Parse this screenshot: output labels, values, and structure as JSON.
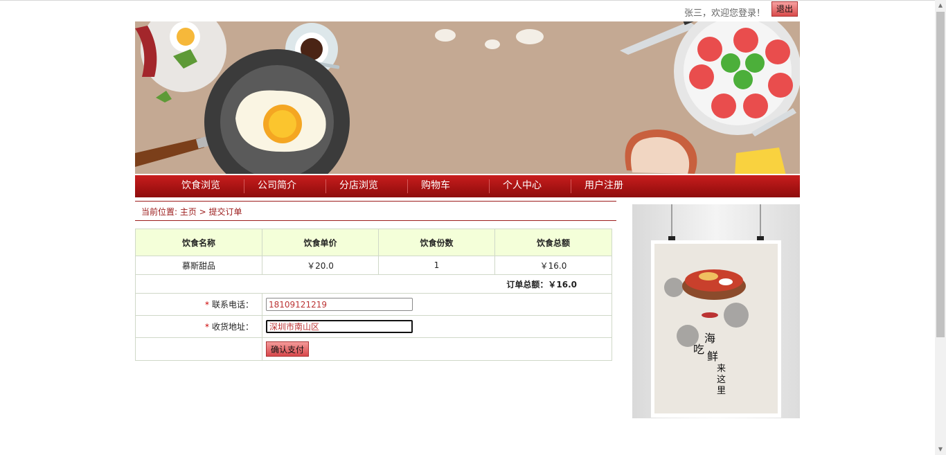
{
  "header": {
    "welcome_text": "张三，欢迎您登录！",
    "logout_label": "退出"
  },
  "nav": {
    "items": [
      "饮食浏览",
      "公司简介",
      "分店浏览",
      "购物车",
      "个人中心",
      "用户注册"
    ]
  },
  "breadcrumb": "当前位置: 主页 > 提交订单",
  "order": {
    "headers": [
      "饮食名称",
      "饮食单价",
      "饮食份数",
      "饮食总额"
    ],
    "row": [
      "慕斯甜品",
      "￥20.0",
      "1",
      "￥16.0"
    ],
    "total_text": "订单总额：￥16.0"
  },
  "form": {
    "phone_label": "联系电话：",
    "phone_value": "18109121219",
    "address_label": "收货地址：",
    "address_value": "深圳市南山区",
    "required_mark": "*",
    "submit_label": "确认支付"
  },
  "poster": {
    "title_chars": [
      "吃",
      "海",
      "鲜",
      "来",
      "这",
      "里"
    ]
  },
  "colors": {
    "brand_red": "#a51212",
    "header_bg": "#f4ffd9",
    "banner_bg": "#c4a993"
  }
}
